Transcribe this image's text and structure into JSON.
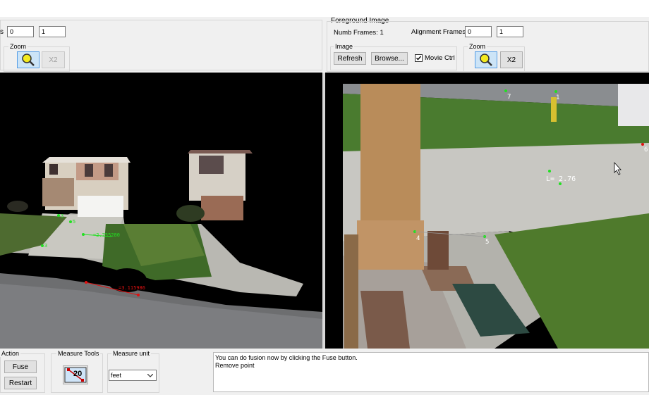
{
  "left_panel": {
    "frames_label_fragment": "s",
    "frame_start": "0",
    "frame_end": "1",
    "zoom": {
      "label": "Zoom",
      "x2_label": "X2"
    }
  },
  "right_panel": {
    "title": "Foreground Image",
    "numb_frames_label": "Numb Frames: 1",
    "alignment_frames_label": "Alignment Frames",
    "alignment_start": "0",
    "alignment_end": "1",
    "image_group": {
      "label": "Image",
      "refresh_label": "Refresh",
      "browse_label": "Browse...",
      "movie_ctrl_label": "Movie Ctrl",
      "movie_ctrl_checked": true
    },
    "zoom": {
      "label": "Zoom",
      "x2_label": "X2"
    }
  },
  "left_view": {
    "measure_labels": [
      "=2.755280",
      "=3.115986"
    ],
    "point_labels": [
      "3",
      "5",
      "3"
    ]
  },
  "right_view": {
    "measurement_label": "L=  2.76",
    "point_labels": [
      "7",
      "1",
      "4",
      "5",
      "6"
    ]
  },
  "bottom": {
    "action": {
      "label": "Action",
      "fuse_label": "Fuse",
      "restart_label": "Restart"
    },
    "measure_tools": {
      "label": "Measure Tools",
      "tool_value": "20"
    },
    "measure_unit": {
      "label": "Measure unit",
      "selected": "feet"
    },
    "messages": [
      "You can do fusion now by clicking the Fuse button.",
      "Remove point"
    ]
  },
  "colors": {
    "accent_green": "#22e022",
    "measure_red": "#e01010",
    "panel": "#f0f0f0"
  }
}
